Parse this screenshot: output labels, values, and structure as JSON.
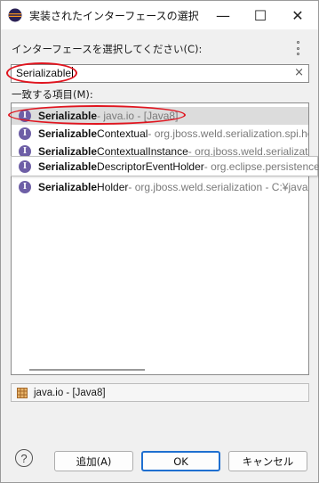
{
  "window": {
    "title": "実装されたインターフェースの選択",
    "minimize_glyph": "—",
    "maximize_glyph": "☐",
    "close_glyph": "✕"
  },
  "filter": {
    "label": "インターフェースを選択してください(C):",
    "value": "Serializable",
    "clear_glyph": "×"
  },
  "matches": {
    "label": "一致する項目(M):",
    "items": [
      {
        "name_bold": "Serializable",
        "name_rest": "",
        "pkg": " - java.io - [Java8]",
        "selected": true
      },
      {
        "name_bold": "Serializable",
        "name_rest": "Contextual",
        "pkg": " - org.jboss.weld.serialization.spi.he",
        "selected": false
      },
      {
        "name_bold": "Serializable",
        "name_rest": "ContextualInstance",
        "pkg": " - org.jboss.weld.serializatio",
        "selected": false
      },
      {
        "name_bold": "Serializable",
        "name_rest": "DescriptorEventHolder",
        "pkg": " - org.eclipse.persistence.c",
        "selected": false
      },
      {
        "name_bold": "Serializable",
        "name_rest": "Holder",
        "pkg": " - org.jboss.weld.serialization - C:¥javae",
        "selected": false
      }
    ]
  },
  "status": {
    "text": "java.io - [Java8]",
    "icon": "package-icon"
  },
  "buttons": {
    "help": "?",
    "add": "追加(A)",
    "ok": "OK",
    "cancel": "キャンセル"
  },
  "colors": {
    "interface_icon": "#6e5fa6",
    "annotation": "#e0141e",
    "selection": "#dcdcdc",
    "ok_border": "#1f6fd0"
  }
}
